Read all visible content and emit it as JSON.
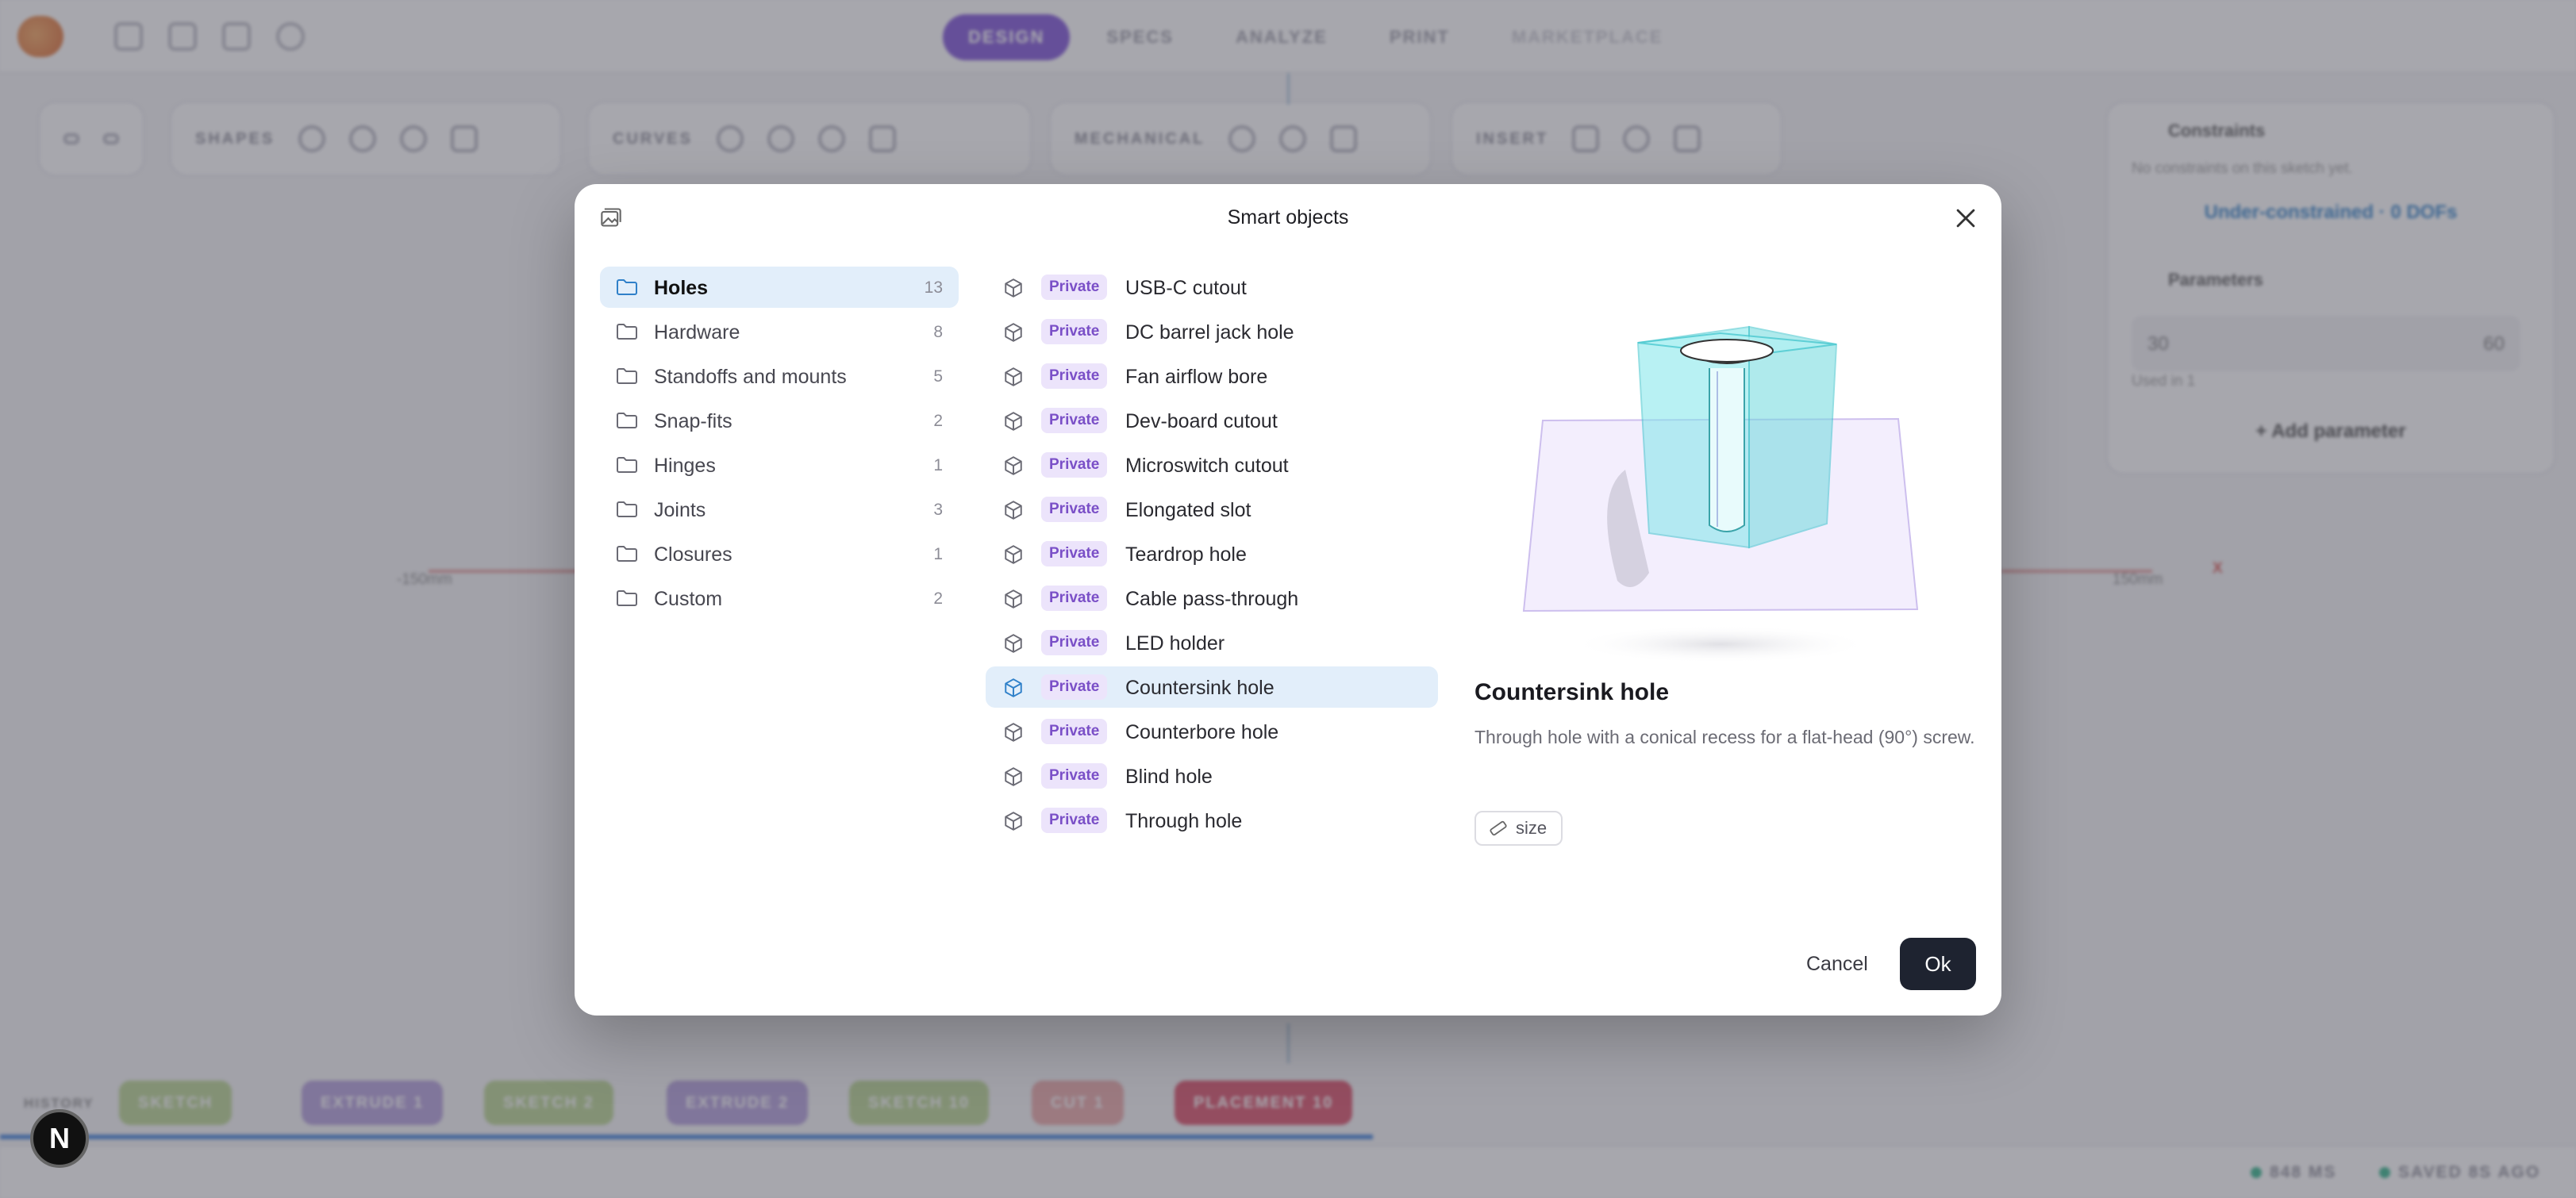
{
  "app": {
    "modes": [
      {
        "label": "DESIGN",
        "active": true
      },
      {
        "label": "SPECS",
        "active": false
      },
      {
        "label": "ANALYZE",
        "active": false
      },
      {
        "label": "PRINT",
        "active": false
      },
      {
        "label": "MARKETPLACE",
        "active": false
      }
    ],
    "toolbar_groups": [
      "SHAPES",
      "CURVES",
      "MECHANICAL",
      "INSERT"
    ],
    "right_panel": {
      "constraints_title": "Constraints",
      "constraints_note": "No constraints on this sketch yet.",
      "constraint_status": "Under-constrained · 0 DOFs",
      "parameters_title": "Parameters",
      "param_name": "30",
      "param_value": "60",
      "param_usage": "Used in 1",
      "add_parameter": "+ Add parameter"
    },
    "canvas_labels": {
      "left": "-150mm",
      "right": "150mm",
      "axis": "X"
    },
    "history": {
      "label": "HISTORY",
      "steps": [
        {
          "label": "SKETCH",
          "color": "#a3c86c"
        },
        {
          "label": "EXTRUDE 1",
          "color": "#9b7fd0"
        },
        {
          "label": "SKETCH 2",
          "color": "#a3c86c"
        },
        {
          "label": "EXTRUDE 2",
          "color": "#9b7fd0"
        },
        {
          "label": "SKETCH 10",
          "color": "#a3c86c"
        },
        {
          "label": "CUT 1",
          "color": "#e58a8a"
        },
        {
          "label": "PLACEMENT 10",
          "color": "#d94a64"
        }
      ]
    },
    "status": {
      "render": "848 MS",
      "saved": "SAVED 8S AGO"
    },
    "badge_letter": "N"
  },
  "dialog": {
    "title": "Smart objects",
    "folders": [
      {
        "name": "Holes",
        "count": "13",
        "selected": true
      },
      {
        "name": "Hardware",
        "count": "8",
        "selected": false
      },
      {
        "name": "Standoffs and mounts",
        "count": "5",
        "selected": false
      },
      {
        "name": "Snap-fits",
        "count": "2",
        "selected": false
      },
      {
        "name": "Hinges",
        "count": "1",
        "selected": false
      },
      {
        "name": "Joints",
        "count": "3",
        "selected": false
      },
      {
        "name": "Closures",
        "count": "1",
        "selected": false
      },
      {
        "name": "Custom",
        "count": "2",
        "selected": false
      }
    ],
    "badge_label": "Private",
    "items": [
      {
        "name": "USB-C cutout",
        "selected": false
      },
      {
        "name": "DC barrel jack hole",
        "selected": false
      },
      {
        "name": "Fan airflow bore",
        "selected": false
      },
      {
        "name": "Dev-board cutout",
        "selected": false
      },
      {
        "name": "Microswitch cutout",
        "selected": false
      },
      {
        "name": "Elongated slot",
        "selected": false
      },
      {
        "name": "Teardrop hole",
        "selected": false
      },
      {
        "name": "Cable pass-through",
        "selected": false
      },
      {
        "name": "LED holder",
        "selected": false
      },
      {
        "name": "Countersink hole",
        "selected": true
      },
      {
        "name": "Counterbore hole",
        "selected": false
      },
      {
        "name": "Blind hole",
        "selected": false
      },
      {
        "name": "Through hole",
        "selected": false
      }
    ],
    "detail": {
      "title": "Countersink hole",
      "description": "Through hole with a conical recess for a flat-head (90°) screw.",
      "tag": "size"
    },
    "cancel_label": "Cancel",
    "ok_label": "Ok"
  },
  "colors": {
    "accent": "#7b4fd6",
    "selection": "#e2eefa",
    "badge_bg": "#ece4fb",
    "badge_text": "#7a4fc7",
    "primary_button": "#1e2330",
    "preview_solid": "#7fe6ea"
  }
}
